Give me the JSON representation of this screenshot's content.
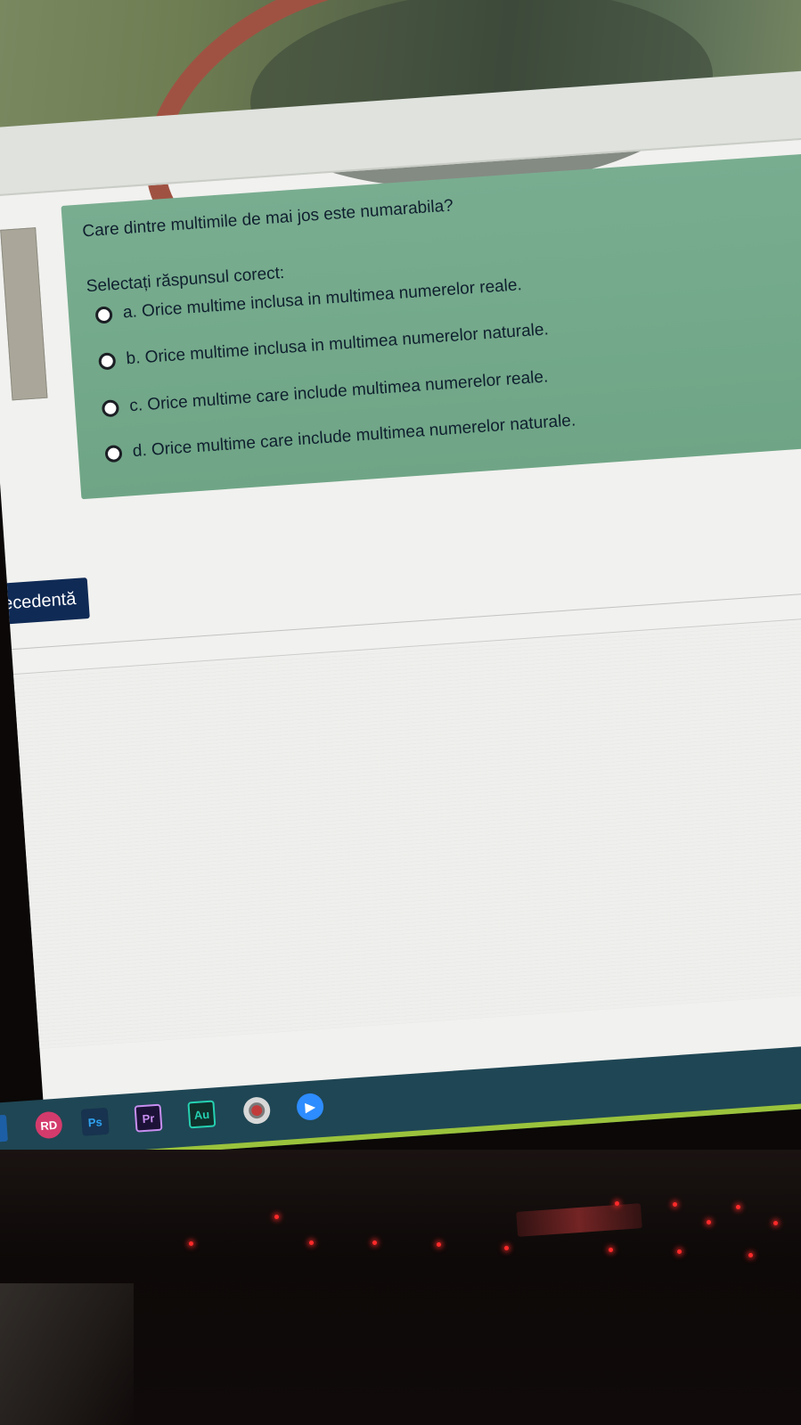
{
  "quiz": {
    "question": "Care dintre multimile de mai jos este numarabila?",
    "prompt": "Selectați răspunsul corect:",
    "options": [
      {
        "label": "a. Orice multime inclusa in multimea numerelor reale."
      },
      {
        "label": "b. Orice multime inclusa in multimea numerelor naturale."
      },
      {
        "label": "c. Orice multime care include multimea numerelor reale."
      },
      {
        "label": "d. Orice multime care include multimea numerelor naturale."
      }
    ]
  },
  "navigation": {
    "previous_label": "ecedentă"
  },
  "taskbar": {
    "icons": [
      {
        "name": "browser-icon",
        "text": ""
      },
      {
        "name": "rd-icon",
        "text": "RD"
      },
      {
        "name": "photoshop-icon",
        "text": "Ps"
      },
      {
        "name": "premiere-icon",
        "text": "Pr"
      },
      {
        "name": "audition-icon",
        "text": "Au"
      },
      {
        "name": "webcam-icon",
        "text": ""
      },
      {
        "name": "zoom-icon",
        "text": ""
      }
    ]
  },
  "colors": {
    "question_card": "#74a98b",
    "primary_button": "#0f2a55",
    "taskbar": "#1f4654",
    "taskbar_accent": "#9bc33c"
  }
}
